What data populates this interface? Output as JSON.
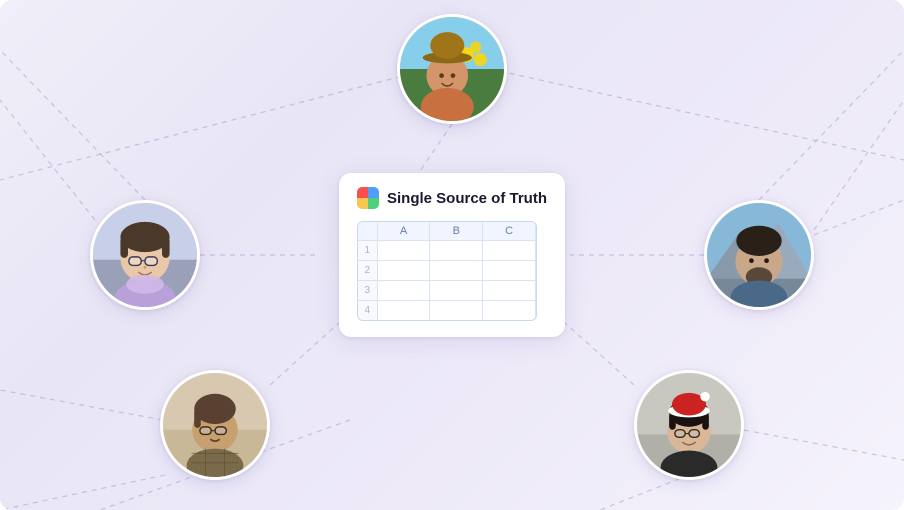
{
  "scene": {
    "title": "Single Source of Truth",
    "card": {
      "logo_alt": "App logo",
      "title": "Single Source of Truth",
      "spreadsheet": {
        "columns": [
          "A",
          "B",
          "C"
        ],
        "rows": [
          {
            "num": "1",
            "a": "",
            "b": "",
            "c": ""
          },
          {
            "num": "2",
            "a": "",
            "b": "",
            "c": ""
          },
          {
            "num": "3",
            "a": "",
            "b": "",
            "c": ""
          },
          {
            "num": "4",
            "a": "",
            "b": "",
            "c": ""
          }
        ]
      }
    },
    "avatars": [
      {
        "id": "top",
        "label": "Person top",
        "color_class": "av1"
      },
      {
        "id": "left",
        "label": "Person left",
        "color_class": "av2"
      },
      {
        "id": "right",
        "label": "Person right",
        "color_class": "av3"
      },
      {
        "id": "bottom-left",
        "label": "Person bottom left",
        "color_class": "av4"
      },
      {
        "id": "bottom-right",
        "label": "Person bottom right",
        "color_class": "av5"
      }
    ]
  }
}
